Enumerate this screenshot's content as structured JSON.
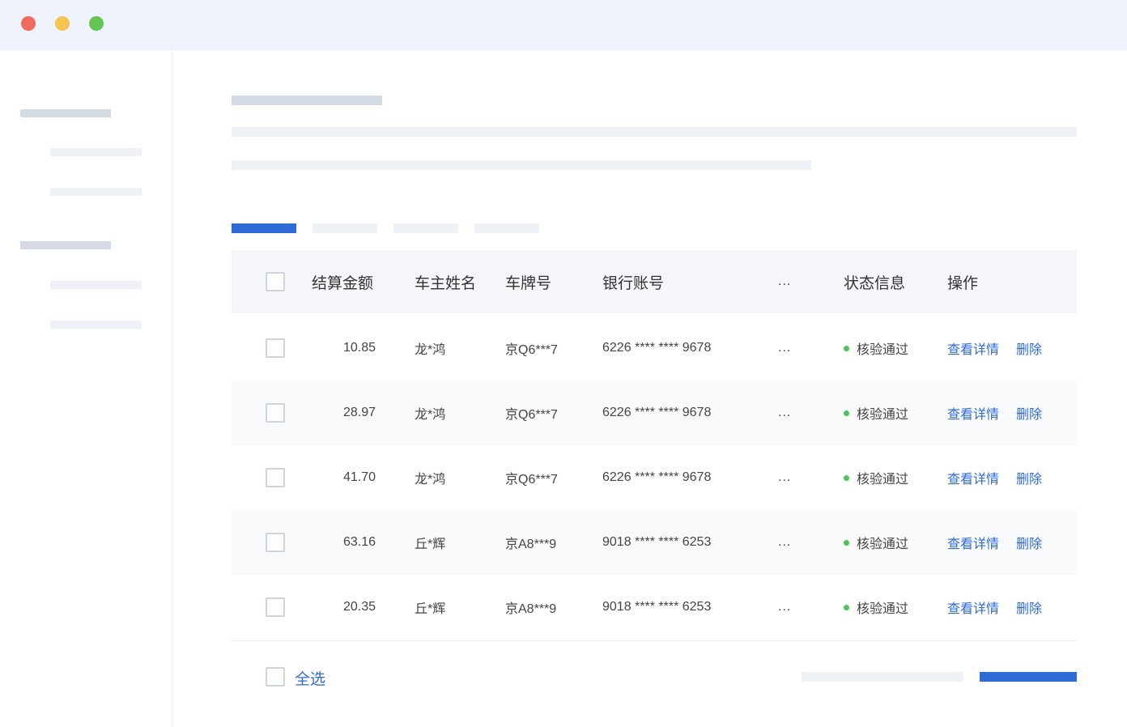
{
  "window": {
    "controls": [
      {
        "name": "close",
        "color": "#ed6b5f"
      },
      {
        "name": "minimize",
        "color": "#f5c451"
      },
      {
        "name": "maximize",
        "color": "#62c554"
      }
    ]
  },
  "colors": {
    "accent": "#2f6bd6",
    "status_ok": "#4fc35a"
  },
  "table": {
    "headers": {
      "amount": "结算金额",
      "owner": "车主姓名",
      "plate": "车牌号",
      "bank": "银行账号",
      "more": "...",
      "status": "状态信息",
      "actions": "操作"
    },
    "rows": [
      {
        "amount": "10.85",
        "owner": "龙*鸿",
        "plate": "京Q6***7",
        "bank": "6226 **** **** 9678",
        "more": "...",
        "status": "核验通过",
        "view": "查看详情",
        "delete": "删除"
      },
      {
        "amount": "28.97",
        "owner": "龙*鸿",
        "plate": "京Q6***7",
        "bank": "6226 **** **** 9678",
        "more": "...",
        "status": "核验通过",
        "view": "查看详情",
        "delete": "删除"
      },
      {
        "amount": "41.70",
        "owner": "龙*鸿",
        "plate": "京Q6***7",
        "bank": "6226 **** **** 9678",
        "more": "...",
        "status": "核验通过",
        "view": "查看详情",
        "delete": "删除"
      },
      {
        "amount": "63.16",
        "owner": "丘*辉",
        "plate": "京A8***9",
        "bank": "9018 **** **** 6253",
        "more": "...",
        "status": "核验通过",
        "view": "查看详情",
        "delete": "删除"
      },
      {
        "amount": "20.35",
        "owner": "丘*辉",
        "plate": "京A8***9",
        "bank": "9018 **** **** 6253",
        "more": "...",
        "status": "核验通过",
        "view": "查看详情",
        "delete": "删除"
      }
    ]
  },
  "footer": {
    "select_all": "全选"
  }
}
